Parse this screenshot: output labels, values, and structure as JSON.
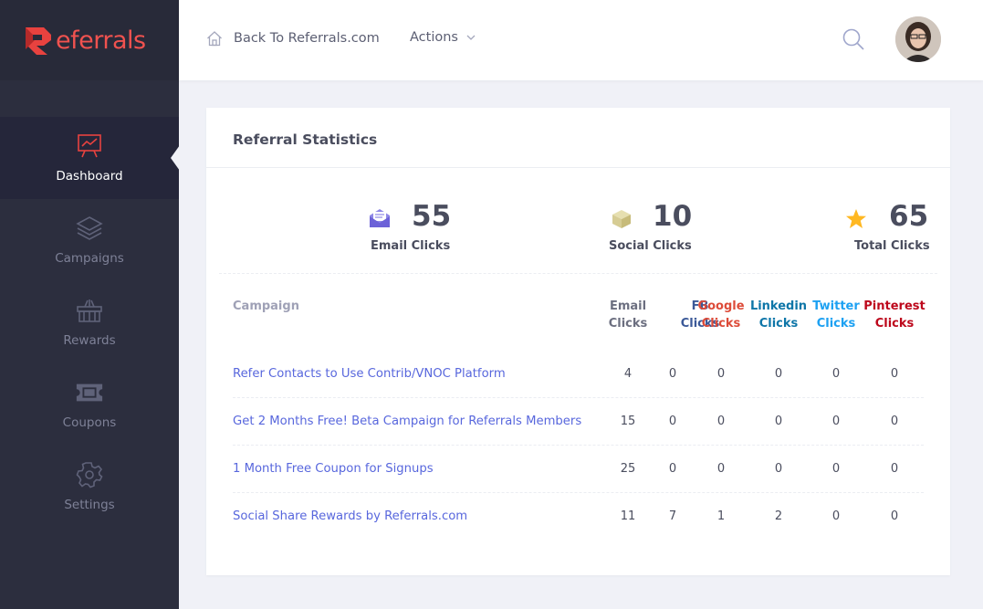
{
  "brand": {
    "logo_text": "eferrals",
    "accent": "#f0524f"
  },
  "sidebar": {
    "items": [
      {
        "label": "Dashboard",
        "icon": "presentation-chart-icon",
        "active": true
      },
      {
        "label": "Campaigns",
        "icon": "layers-icon",
        "active": false
      },
      {
        "label": "Rewards",
        "icon": "gift-basket-icon",
        "active": false
      },
      {
        "label": "Coupons",
        "icon": "ticket-icon",
        "active": false
      },
      {
        "label": "Settings",
        "icon": "gear-icon",
        "active": false
      }
    ]
  },
  "header": {
    "back_label": "Back To Referrals.com",
    "actions_label": "Actions"
  },
  "card": {
    "title": "Referral Statistics",
    "stats": [
      {
        "value": "55",
        "label": "Email Clicks",
        "icon": "envelope-icon"
      },
      {
        "value": "10",
        "label": "Social Clicks",
        "icon": "box-icon"
      },
      {
        "value": "65",
        "label": "Total Clicks",
        "icon": "star-icon"
      }
    ],
    "table": {
      "headers": [
        {
          "line1": "Campaign",
          "line2": "",
          "color": "#9fa1b6"
        },
        {
          "line1": "Email",
          "line2": "Clicks",
          "color": "#6c6f80"
        },
        {
          "line1": "FB",
          "line2": "Clicks",
          "color": "#3b5998"
        },
        {
          "line1": "Google",
          "line2": "Clicks",
          "color": "#dd4b39"
        },
        {
          "line1": "Linkedin",
          "line2": "Clicks",
          "color": "#0e76a8"
        },
        {
          "line1": "Twitter",
          "line2": "Clicks",
          "color": "#1da1f2"
        },
        {
          "line1": "Pinterest",
          "line2": "Clicks",
          "color": "#bd081c"
        }
      ],
      "rows": [
        {
          "campaign": "Refer Contacts to Use Contrib/VNOC Platform",
          "email": "4",
          "fb": "0",
          "google": "0",
          "linkedin": "0",
          "twitter": "0",
          "pinterest": "0"
        },
        {
          "campaign": "Get 2 Months Free! Beta Campaign for Referrals Members",
          "email": "15",
          "fb": "0",
          "google": "0",
          "linkedin": "0",
          "twitter": "0",
          "pinterest": "0"
        },
        {
          "campaign": "1 Month Free Coupon for Signups",
          "email": "25",
          "fb": "0",
          "google": "0",
          "linkedin": "0",
          "twitter": "0",
          "pinterest": "0"
        },
        {
          "campaign": "Social Share Rewards by Referrals.com",
          "email": "11",
          "fb": "7",
          "google": "1",
          "linkedin": "2",
          "twitter": "0",
          "pinterest": "0"
        }
      ]
    }
  }
}
